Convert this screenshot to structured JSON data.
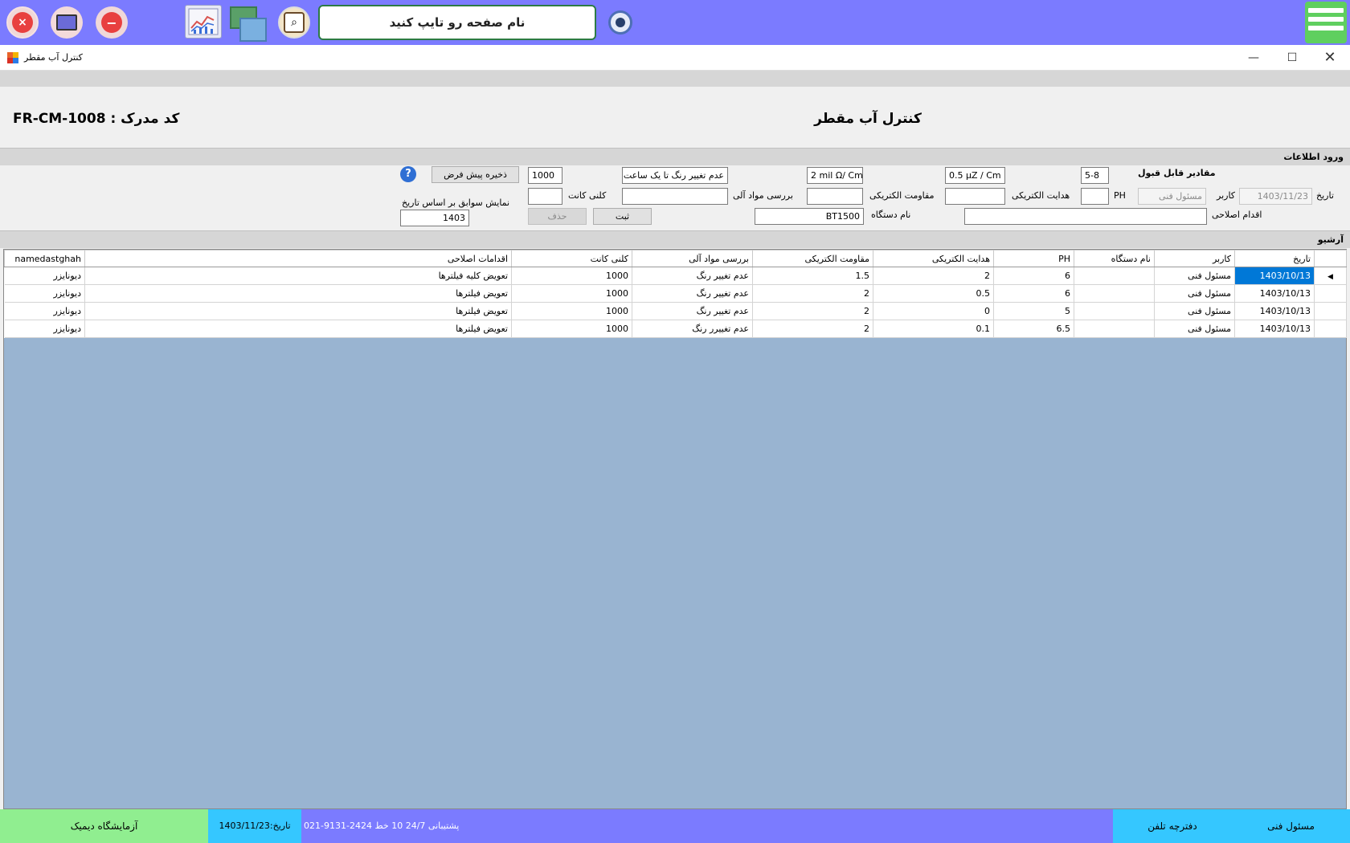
{
  "toolbar": {
    "page_search_placeholder": "نام صفحه رو تایپ کنید"
  },
  "window": {
    "title": "کنترل آب مقطر"
  },
  "header": {
    "doc_code": "FR-CM-1008  :  کد مدرک",
    "form_title": "کنترل آب مقطر"
  },
  "input_section": {
    "title": "ورود اطلاعات",
    "acceptable_values_label": "مقادیر قابل قبول",
    "ph_range": "5-8",
    "conductivity_value": "0.5 μZ / Cm",
    "resistance_value": "2 mil Ω/ Cm",
    "organic_value": "عدم تغییر رنگ تا یک ساعت",
    "colony_value": "1000",
    "save_default_button": "ذخیره پیش فرض",
    "date_label": "تاریخ",
    "date_value": "1403/11/23",
    "user_label": "کاربر",
    "user_value": "مسئول فنی",
    "ph_label": "PH",
    "conductivity_label": "هدایت الکتریکی",
    "resistance_label": "مقاومت الکتریکی",
    "organic_label": "بررسی مواد آلی",
    "colony_label": "کلنی کانت",
    "history_label": "نمایش سوابق بر اساس تاریخ",
    "corrective_label": "اقدام اصلاحی",
    "device_label": "نام دستگاه",
    "device_value": "BT1500",
    "submit_button": "ثبت",
    "delete_button": "حذف",
    "history_year": "1403"
  },
  "archive": {
    "title": "آرشیو",
    "columns": [
      "namedastghah",
      "اقدامات اصلاحی",
      "کلنی کانت",
      "بررسی مواد آلی",
      "مقاومت الکتریکی",
      "هدایت الکتریکی",
      "PH",
      "نام دستگاه",
      "کاربر",
      "تاریخ"
    ],
    "rows": [
      [
        "دیونایزر",
        "تعویض کلیه فیلترها",
        "1000",
        "عدم تغییر رنگ",
        "1.5",
        "2",
        "6",
        "",
        "مسئول فنی",
        "1403/10/13"
      ],
      [
        "دیونایزر",
        "تعویض فیلترها",
        "1000",
        "عدم تغییر رنگ",
        "2",
        "0.5",
        "6",
        "",
        "مسئول فنی",
        "1403/10/13"
      ],
      [
        "دیونایزر",
        "تعویض فیلترها",
        "1000",
        "عدم تغییر رنگ",
        "2",
        "0",
        "5",
        "",
        "مسئول فنی",
        "1403/10/13"
      ],
      [
        "دیونایزر",
        "تعویض فیلترها",
        "1000",
        "عدم تغییرر رنگ",
        "2",
        "0.1",
        "6.5",
        "",
        "مسئول فنی",
        "1403/10/13"
      ]
    ]
  },
  "status": {
    "lab_name": "آزمایشگاه دیمیک",
    "date": "تاریخ:1403/11/23",
    "support": "پشتیبانی 24/7   10 خط  2424-9131-021",
    "phonebook": "دفترچه تلفن",
    "user": "مسئول فنی"
  },
  "colors": {
    "toolbar": "#7b7bff",
    "accent_green": "#90ee90",
    "accent_cyan": "#35c7ff",
    "selection": "#0078d7",
    "grid_background": "#99b4d1"
  }
}
